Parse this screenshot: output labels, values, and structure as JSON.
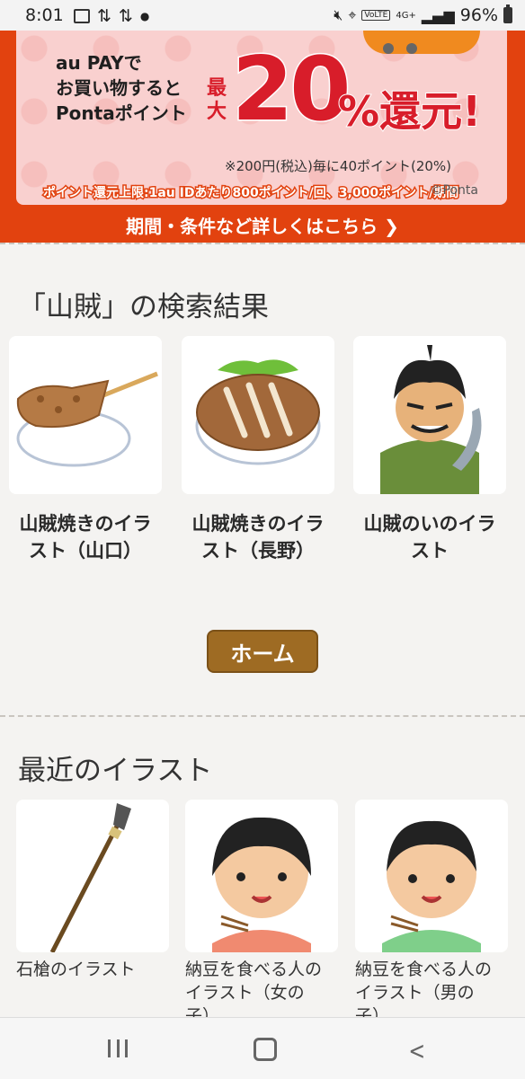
{
  "status": {
    "time": "8:01",
    "battery": "96%",
    "network": "4G+",
    "volte": "VoLTE"
  },
  "banner": {
    "line1": "au PAYで",
    "line2": "お買い物すると",
    "line3": "Pontaポイント",
    "max_label": "最大",
    "percent": "20",
    "percent_suffix": "%還元!",
    "note": "※200円(税込)毎に40ポイント(20%)",
    "limit": "ポイント還元上限:1au IDあたり800ポイント/回、3,000ポイント/期間",
    "ponta_mark": "©Ponta",
    "link": "期間・条件など詳しくはこちら ❯"
  },
  "search": {
    "title": "「山賊」の検索結果",
    "results": [
      {
        "title_line1": "山賊焼きのイラ",
        "title_line2": "スト（山口）"
      },
      {
        "title_line1": "山賊焼きのイラ",
        "title_line2": "スト（長野）"
      },
      {
        "title_line1": "山賊のいのイラ",
        "title_line2": "スト"
      }
    ]
  },
  "home_button": "ホーム",
  "recent": {
    "title": "最近のイラスト",
    "items": [
      {
        "line1": "石槍のイラスト",
        "line2": ""
      },
      {
        "line1": "納豆を食べる人の",
        "line2": "イラスト（女の",
        "line3": "子）"
      },
      {
        "line1": "納豆を食べる人の",
        "line2": "イラスト（男の",
        "line3": "子）"
      }
    ]
  },
  "colors": {
    "banner_orange": "#e2420f",
    "banner_pink": "#f9d0cf",
    "accent_red": "#d81d2a",
    "home_button": "#9e6b23",
    "page_bg": "#f4f3f1"
  }
}
